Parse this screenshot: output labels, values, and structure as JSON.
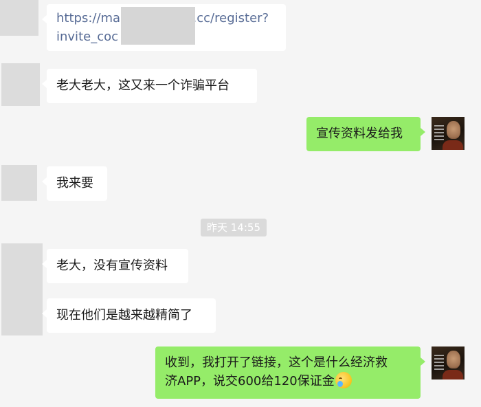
{
  "messages": [
    {
      "side": "left",
      "lines": [
        "https://ma▒▒▒▒▒▒▒6.cc/register?",
        "invite_coc▒▒▒▒▒▒▒▒"
      ]
    },
    {
      "side": "left",
      "lines": [
        "老大老大，这又来一个诈骗平台"
      ]
    },
    {
      "side": "right",
      "lines": [
        "宣传资料发给我"
      ]
    },
    {
      "side": "left",
      "lines": [
        "我来要"
      ]
    },
    {
      "side": "left",
      "lines": [
        "老大，没有宣传资料"
      ]
    },
    {
      "side": "left",
      "lines": [
        "现在他们是越来越精简了"
      ]
    },
    {
      "side": "right",
      "lines": [
        "收到，我打开了链接，这个是什么经济救",
        "济APP，说交600给120保证金"
      ]
    }
  ],
  "timestamp": "昨天 14:55",
  "link_visible": {
    "line1_start": "https://ma",
    "line1_end": "6.cc/register?",
    "line2_start": "invite_coc"
  },
  "colors": {
    "bubble_sent": "#95ec69",
    "bubble_received": "#ffffff",
    "link": "#576b95",
    "background": "#f5f5f5"
  },
  "icons": {
    "last_message_emoji": "crying-laughing-emoji"
  }
}
